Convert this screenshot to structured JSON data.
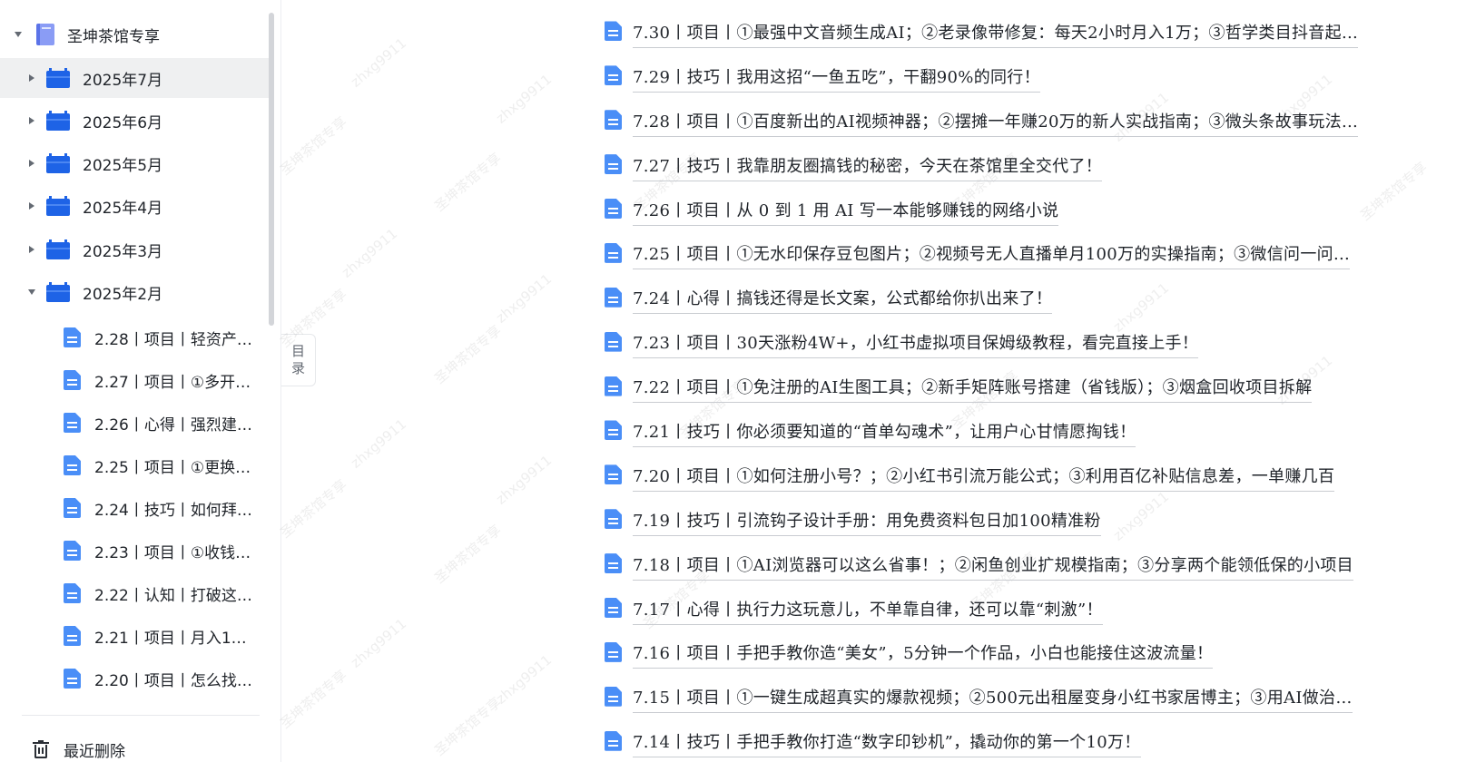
{
  "sidebar": {
    "root": {
      "label": "圣坤茶馆专享",
      "icon": "book-icon",
      "expanded": true
    },
    "months": [
      {
        "label": "2025年7月",
        "expanded": false,
        "selected": true
      },
      {
        "label": "2025年6月",
        "expanded": false,
        "selected": false
      },
      {
        "label": "2025年5月",
        "expanded": false,
        "selected": false
      },
      {
        "label": "2025年4月",
        "expanded": false,
        "selected": false
      },
      {
        "label": "2025年3月",
        "expanded": false,
        "selected": false
      },
      {
        "label": "2025年2月",
        "expanded": true,
        "selected": false
      }
    ],
    "feb_docs": [
      "2.28丨项目丨轻资产…",
      "2.27丨项目丨①多开…",
      "2.26丨心得丨强烈建…",
      "2.25丨项目丨①更换…",
      "2.24丨技巧丨如何拜…",
      "2.23丨项目丨①收钱…",
      "2.22丨认知丨打破这…",
      "2.21丨项目丨月入1…",
      "2.20丨项目丨怎么找…"
    ],
    "trash": {
      "label": "最近删除",
      "icon": "trash-icon"
    }
  },
  "toc_tab": {
    "line1": "目",
    "line2": "录"
  },
  "doc_list": [
    "7.30丨项目丨①最强中文音频生成AI；②老录像带修复：每天2小时月入1万；③哲学类目抖音起…",
    "7.29丨技巧丨我用这招“一鱼五吃”，干翻90%的同行！",
    "7.28丨项目丨①百度新出的AI视频神器；②摆摊一年赚20万的新人实战指南；③微头条故事玩法…",
    "7.27丨技巧丨我靠朋友圈搞钱的秘密，今天在茶馆里全交代了！",
    "7.26丨项目丨从 0 到 1 用 AI 写一本能够赚钱的网络小说",
    "7.25丨项目丨①无水印保存豆包图片；②视频号无人直播单月100万的实操指南；③微信问一问…",
    "7.24丨心得丨搞钱还得是长文案，公式都给你扒出来了！",
    "7.23丨项目丨30天涨粉4W+，小红书虚拟项目保姆级教程，看完直接上手！",
    "7.22丨项目丨①免注册的AI生图工具；②新手矩阵账号搭建（省钱版）；③烟盒回收项目拆解",
    "7.21丨技巧丨你必须要知道的“首单勾魂术”，让用户心甘情愿掏钱！",
    "7.20丨项目丨①如何注册小号？；②小红书引流万能公式；③利用百亿补贴信息差，一单赚几百",
    "7.19丨技巧丨引流钩子设计手册：用免费资料包日加100精准粉",
    "7.18丨项目丨①AI浏览器可以这么省事！；②闲鱼创业扩规模指南；③分享两个能领低保的小项目",
    "7.17丨心得丨执行力这玩意儿，不单靠自律，还可以靠“刺激”！",
    "7.16丨项目丨手把手教你造“美女”，5分钟一个作品，小白也能接住这波流量！",
    "7.15丨项目丨①一键生成超真实的爆款视频；②500元出租屋变身小红书家居博主；③用AI做治…",
    "7.14丨技巧丨手把手教你打造“数字印钞机”，撬动你的第一个10万！"
  ],
  "watermark": {
    "texts": [
      "圣坤茶馆专享",
      "zhxg9911"
    ]
  },
  "colors": {
    "folder": "#1e63e6",
    "doc_icon": "#4a8ef7",
    "book_icon": "#5b73e8",
    "selected_row": "#eff0f1",
    "text": "#1f2329"
  }
}
